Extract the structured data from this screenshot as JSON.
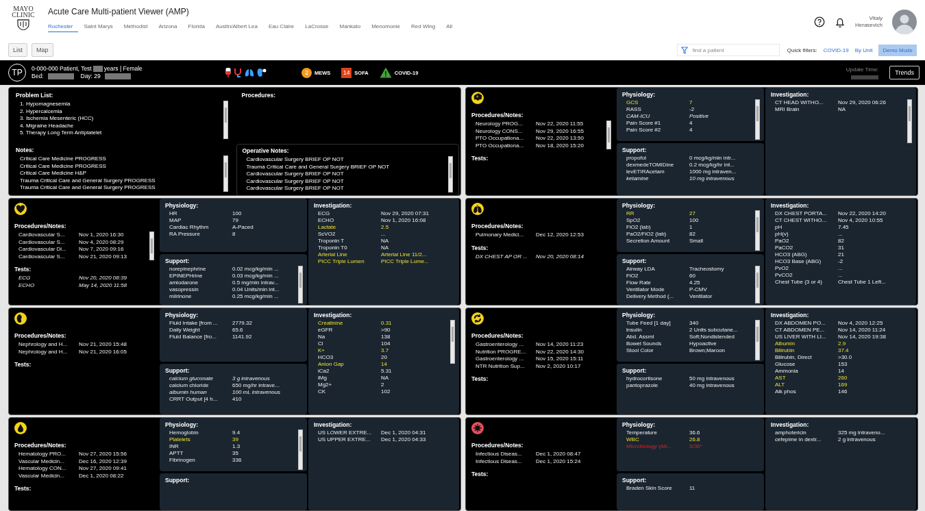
{
  "header": {
    "logo": [
      "MAYO",
      "CLINIC"
    ],
    "title": "Acute Care Multi-patient Viewer (AMP)",
    "locations": [
      {
        "label": "Rochester",
        "selected": true
      },
      {
        "label": "Saint Marys",
        "selected": false
      },
      {
        "label": "Methodist",
        "selected": false
      },
      {
        "label": "Arizona",
        "selected": false
      },
      {
        "label": "Florida",
        "selected": false
      },
      {
        "label": "Austin/Albert Lea",
        "selected": false
      },
      {
        "label": "Eau Claire",
        "selected": false
      },
      {
        "label": "LaCrosse",
        "selected": false
      },
      {
        "label": "Mankato",
        "selected": false
      },
      {
        "label": "Menomonie",
        "selected": false
      },
      {
        "label": "Red Wing",
        "selected": false
      },
      {
        "label": "All",
        "selected": false
      }
    ],
    "user": [
      "Vitaly",
      "Herasevich"
    ]
  },
  "toolbar": {
    "views": [
      "List",
      "Map"
    ],
    "search": {
      "placeholder": "find a patient"
    },
    "quick_filters_label": "Quick filters:",
    "quick_filters": [
      "COVID-19",
      "By Unit"
    ],
    "demo_mode": {
      "label": "Demo Mode",
      "on": true
    }
  },
  "patient": {
    "initials": "TP",
    "name": "0-000-000 Patient, Test",
    "age_sex": "years | Female",
    "bed_label": "Bed:",
    "day": "Day: 29",
    "scores": [
      {
        "kind": "circle",
        "value": "2",
        "label": "MEWS",
        "color": "#f39a1e"
      },
      {
        "kind": "square",
        "value": "14",
        "label": "SOFA",
        "color": "#e0401a"
      },
      {
        "kind": "triangle",
        "value": "!",
        "label": "COVID-19",
        "color": "#3fa535"
      }
    ],
    "update_label": "Update Time:",
    "trends": "Trends"
  },
  "panels": [
    {
      "kind": "summary",
      "problem_list": {
        "title": "Problem List:",
        "scrollbar": true,
        "items": [
          "1. Hypomagnesemia",
          "2. Hypercalcemia",
          "3. Ischemia Mesenteric (HCC)",
          "4. Migraine Headache",
          "5. Therapy Long Term Antiplatelet"
        ]
      },
      "notes": {
        "title": "Notes:",
        "scrollbar": true,
        "items": [
          "Critical Care Medicine PROGRESS",
          "Critical Care Medicine PROGRESS",
          "Critical Care Medicine H&P",
          "Trauma Critical Care and General Surgery PROGRESS",
          "Trauma Critical Care and General Surgery PROGRESS"
        ]
      },
      "procedures": {
        "title": "Procedures:"
      },
      "operative_notes": {
        "title": "Operative Notes:",
        "scrollbar": true,
        "items": [
          "Cardiovascular Surgery BRIEF OP NOT",
          "Trauma Critical Care and General Surgery BRIEF OP NOT",
          "Cardiovascular Surgery BRIEF OP NOT",
          "Cardiovascular Surgery BRIEF OP NOT",
          "Cardiovascular Surgery BRIEF OP NOT"
        ]
      }
    },
    {
      "kind": "neuro",
      "color": "#f2d31b",
      "notes": {
        "title": "Procedures/Notes:",
        "scrollbar": true,
        "rows": [
          {
            "label": "Neurology PROG...",
            "value": "Nov 22, 2020 11:55"
          },
          {
            "label": "Neurology CONS...",
            "value": "Nov 29, 2020 16:55"
          },
          {
            "label": "PTO Occupationa...",
            "value": "Nov 22, 2020 13:50"
          },
          {
            "label": "PTO Occupationa...",
            "value": "Nov 18, 2020 15:20"
          }
        ]
      },
      "tests": {
        "title": "Tests:"
      },
      "physiology": {
        "title": "Physiology:",
        "scrollbar": true,
        "rows": [
          {
            "label": "GCS",
            "value": "7",
            "abnormal": true,
            "stale": false
          },
          {
            "label": "RASS",
            "value": "-2",
            "abnormal": false,
            "stale": false
          },
          {
            "label": "CAM-ICU",
            "value": "Positive",
            "abnormal": false,
            "stale": true
          },
          {
            "label": "Pain Score #1",
            "value": "4",
            "abnormal": false,
            "stale": false
          },
          {
            "label": "Pain Score #2",
            "value": "4",
            "abnormal": false,
            "stale": false
          }
        ]
      },
      "support": {
        "title": "Support:",
        "rows": [
          {
            "label": "propofol",
            "value": "0 mcg/kg/min intr...",
            "abnormal": false,
            "stale": false
          },
          {
            "label": "dexmedeTOMIDine",
            "value": "0.2 mcg/kg/hr int...",
            "abnormal": false,
            "stale": false
          },
          {
            "label": "levETIRAcetam",
            "value": "1000 mg intraven...",
            "abnormal": false,
            "stale": false
          },
          {
            "label": "ketamine",
            "value": "10 mg intravenous",
            "abnormal": false,
            "stale": true
          }
        ]
      },
      "investigation": {
        "title": "Investigation:",
        "scrollbar": true,
        "rows": [
          {
            "label": "CT HEAD WITHO...",
            "value": "Nov 29, 2020 06:26",
            "abnormal": false,
            "stale": false
          },
          {
            "label": "MRI Brain",
            "value": "NA",
            "abnormal": false,
            "stale": false
          }
        ]
      }
    },
    {
      "kind": "cardio",
      "color": "#f2d31b",
      "notes": {
        "title": "Procedures/Notes:",
        "scrollbar": true,
        "rows": [
          {
            "label": "Cardiovascular S...",
            "value": "Nov 1, 2020 16:30"
          },
          {
            "label": "Cardiovascular S...",
            "value": "Nov 4, 2020 08:29"
          },
          {
            "label": "Cardiovascular Di...",
            "value": "Nov 7, 2020 09:16"
          },
          {
            "label": "Cardiovascular S...",
            "value": "Nov 21, 2020 09:13"
          }
        ]
      },
      "tests": {
        "title": "Tests:",
        "rows": [
          {
            "label": "ECG",
            "value": "Nov 20, 2020 08:39",
            "stale": true
          },
          {
            "label": "ECHO",
            "value": "May 14, 2020 11:58",
            "stale": true
          }
        ]
      },
      "physiology": {
        "title": "Physiology:",
        "rows": [
          {
            "label": "HR",
            "value": "100",
            "abnormal": false,
            "stale": false
          },
          {
            "label": "MAP",
            "value": "79",
            "abnormal": false,
            "stale": false
          },
          {
            "label": "Cardiac Rhythm",
            "value": "A-Paced",
            "abnormal": false,
            "stale": false
          },
          {
            "label": "RA Pressure",
            "value": "8",
            "abnormal": false,
            "stale": false
          }
        ]
      },
      "support": {
        "title": "Support:",
        "scrollbar": true,
        "rows": [
          {
            "label": "norepinephrine",
            "value": "0.02 mcg/kg/min ...",
            "abnormal": false,
            "stale": false
          },
          {
            "label": "EPINEPHrine",
            "value": "0.03 mcg/kg/min ...",
            "abnormal": false,
            "stale": false
          },
          {
            "label": "amiodarone",
            "value": "0.5 mg/min intrav...",
            "abnormal": false,
            "stale": false
          },
          {
            "label": "vasopressin",
            "value": "0.04 Units/min int...",
            "abnormal": false,
            "stale": false
          },
          {
            "label": "milrinone",
            "value": "0.25 mcg/kg/min ...",
            "abnormal": false,
            "stale": false
          }
        ]
      },
      "investigation": {
        "title": "Investigation:",
        "rows": [
          {
            "label": "ECG",
            "value": "Nov 29, 2020 07:31",
            "abnormal": false,
            "stale": false
          },
          {
            "label": "ECHO",
            "value": "Nov 1, 2020 16:08",
            "abnormal": false,
            "stale": false
          },
          {
            "label": "Lactate",
            "value": "2.5",
            "abnormal": true,
            "stale": false
          },
          {
            "label": "ScVO2",
            "value": "...",
            "abnormal": false,
            "stale": false
          },
          {
            "label": "Troponin T",
            "value": "NA",
            "abnormal": false,
            "stale": false
          },
          {
            "label": "Troponin T0",
            "value": "NA",
            "abnormal": false,
            "stale": false
          },
          {
            "label": "Arterial Line",
            "value": "Arterial Line 11/2...",
            "abnormal": true,
            "stale": false
          },
          {
            "label": "PICC Triple Lumen",
            "value": "PICC Triple Lume...",
            "abnormal": true,
            "stale": false
          }
        ]
      }
    },
    {
      "kind": "resp",
      "color": "#f2d31b",
      "notes": {
        "title": "Procedures/Notes:",
        "rows": [
          {
            "label": "Pulmonary Medici...",
            "value": "Dec 12, 2020 12:53"
          }
        ]
      },
      "tests": {
        "title": "Tests:",
        "rows": [
          {
            "label": "DX CHEST AP OR ...",
            "value": "Nov 20, 2020 08:14",
            "stale": true
          }
        ]
      },
      "physiology": {
        "title": "Physiology:",
        "scrollbar": true,
        "rows": [
          {
            "label": "RR",
            "value": "27",
            "abnormal": true,
            "stale": false
          },
          {
            "label": "SpO2",
            "value": "100",
            "abnormal": false,
            "stale": false
          },
          {
            "label": "FiO2 (lab)",
            "value": "1",
            "abnormal": false,
            "stale": false
          },
          {
            "label": "PaO2/FiO2 (lab)",
            "value": "82",
            "abnormal": false,
            "stale": false
          },
          {
            "label": "Secretion Amount",
            "value": "Small",
            "abnormal": false,
            "stale": false
          }
        ]
      },
      "support": {
        "title": "Support:",
        "scrollbar": true,
        "rows": [
          {
            "label": "Airway LDA",
            "value": "Tracheostomy",
            "abnormal": false,
            "stale": false
          },
          {
            "label": "FiO2",
            "value": "60",
            "abnormal": false,
            "stale": false
          },
          {
            "label": "Flow Rate",
            "value": "4.25",
            "abnormal": false,
            "stale": false
          },
          {
            "label": "Ventilator Mode",
            "value": "P-CMV",
            "abnormal": false,
            "stale": false
          },
          {
            "label": "Delivery Method (...",
            "value": "Ventilator",
            "abnormal": false,
            "stale": false
          }
        ]
      },
      "investigation": {
        "title": "Investigation:",
        "rows": [
          {
            "label": "DX CHEST PORTA...",
            "value": "Nov 22, 2020 14:20",
            "abnormal": false,
            "stale": false
          },
          {
            "label": "CT CHEST WITHO...",
            "value": "Nov 4, 2020 10:55",
            "abnormal": false,
            "stale": false
          },
          {
            "label": "pH",
            "value": "7.45",
            "abnormal": false,
            "stale": false
          },
          {
            "label": "pH(v)",
            "value": "...",
            "abnormal": false,
            "stale": false
          },
          {
            "label": "PaO2",
            "value": "82",
            "abnormal": false,
            "stale": false
          },
          {
            "label": "PaCO2",
            "value": "31",
            "abnormal": false,
            "stale": false
          },
          {
            "label": "HCO3 (ABG)",
            "value": "21",
            "abnormal": false,
            "stale": false
          },
          {
            "label": "HCO3 Base (ABG)",
            "value": "-2",
            "abnormal": false,
            "stale": false
          },
          {
            "label": "PvO2",
            "value": "...",
            "abnormal": false,
            "stale": false
          },
          {
            "label": "PvCO2",
            "value": "...",
            "abnormal": false,
            "stale": false
          },
          {
            "label": "Chest Tube (3 or 4)",
            "value": "Chest Tube 1 Left...",
            "abnormal": false,
            "stale": false
          }
        ]
      }
    },
    {
      "kind": "renal",
      "color": "#f2d31b",
      "notes": {
        "title": "Procedures/Notes:",
        "rows": [
          {
            "label": "Nephrology and H...",
            "value": "Nov 21, 2020 15:48"
          },
          {
            "label": "Nephrology and H...",
            "value": "Nov 21, 2020 16:05"
          }
        ]
      },
      "tests": {
        "title": "Tests:"
      },
      "physiology": {
        "title": "Physiology:",
        "rows": [
          {
            "label": "Fluid Intake [from ...",
            "value": "2779.32",
            "abnormal": false,
            "stale": false
          },
          {
            "label": "Daily Weight",
            "value": "65.6",
            "abnormal": false,
            "stale": false
          },
          {
            "label": "Fluid Balance [fro...",
            "value": "1141.92",
            "abnormal": false,
            "stale": false
          }
        ]
      },
      "support": {
        "title": "Support:",
        "rows": [
          {
            "label": "calcium gluconate",
            "value": "3 g intravenous",
            "abnormal": false,
            "stale": true
          },
          {
            "label": "calcium chloride",
            "value": "650 mg/hr intrave...",
            "abnormal": false,
            "stale": false
          },
          {
            "label": "albumin human",
            "value": "100 mL intravenous",
            "abnormal": false,
            "stale": true
          },
          {
            "label": "CRRT Output [4 h...",
            "value": "410",
            "abnormal": false,
            "stale": false
          }
        ]
      },
      "investigation": {
        "title": "Investigation:",
        "scrollbar": true,
        "rows": [
          {
            "label": "Creatinine",
            "value": "0.31",
            "abnormal": true,
            "stale": false
          },
          {
            "label": "eGFR",
            "value": ">90",
            "abnormal": false,
            "stale": false
          },
          {
            "label": "Na",
            "value": "138",
            "abnormal": false,
            "stale": false
          },
          {
            "label": "Cl",
            "value": "104",
            "abnormal": false,
            "stale": false
          },
          {
            "label": "K+",
            "value": "3.7",
            "abnormal": true,
            "stale": false
          },
          {
            "label": "HCO3",
            "value": "20",
            "abnormal": false,
            "stale": false
          },
          {
            "label": "Anion Gap",
            "value": "14",
            "abnormal": true,
            "stale": false
          },
          {
            "label": "iCa2",
            "value": "5.31",
            "abnormal": false,
            "stale": false
          },
          {
            "label": "iMg",
            "value": "NA",
            "abnormal": false,
            "stale": false
          },
          {
            "label": "Mg2+",
            "value": "2",
            "abnormal": false,
            "stale": false
          },
          {
            "label": "CK",
            "value": "102",
            "abnormal": false,
            "stale": false
          }
        ]
      }
    },
    {
      "kind": "gi",
      "color": "#f2d31b",
      "notes": {
        "title": "Procedures/Notes:",
        "rows": [
          {
            "label": "Gastroenterology ...",
            "value": "Nov 14, 2020 11:23"
          },
          {
            "label": "Nutrition PROGRE...",
            "value": "Nov 22, 2020 14:30"
          },
          {
            "label": "Gastroenterology ...",
            "value": "Nov 15, 2020 15:11"
          },
          {
            "label": "NTR Nutrition Sup...",
            "value": "Nov 2, 2020 10:17"
          }
        ]
      },
      "tests": {
        "title": "Tests:"
      },
      "physiology": {
        "title": "Physiology:",
        "scrollbar": true,
        "rows": [
          {
            "label": "Tube Feed [1 day]",
            "value": "340",
            "abnormal": false,
            "stale": false
          },
          {
            "label": "insulin",
            "value": "2 Units subcutane...",
            "abnormal": false,
            "stale": false
          },
          {
            "label": "Abd. Assmt",
            "value": "Soft;Nondistended",
            "abnormal": false,
            "stale": false
          },
          {
            "label": "Bowel Sounds",
            "value": "Hypoactive",
            "abnormal": false,
            "stale": false
          },
          {
            "label": "Stool Color",
            "value": "Brown;Maroon",
            "abnormal": false,
            "stale": false
          }
        ]
      },
      "support": {
        "title": "Support:",
        "rows": [
          {
            "label": "hydrocortisone",
            "value": "50 mg intravenous",
            "abnormal": false,
            "stale": false
          },
          {
            "label": "pantoprazole",
            "value": "40 mg intravenous",
            "abnormal": false,
            "stale": false
          }
        ]
      },
      "investigation": {
        "title": "Investigation:",
        "rows": [
          {
            "label": "DX ABDOMEN PO...",
            "value": "Nov 4, 2020 12:25",
            "abnormal": false,
            "stale": false
          },
          {
            "label": "CT ABDOMEN PE...",
            "value": "Nov 14, 2020 11:24",
            "abnormal": false,
            "stale": false
          },
          {
            "label": "US LIVER WITH LI...",
            "value": "Nov 14, 2020 19:38",
            "abnormal": false,
            "stale": false
          },
          {
            "label": "Albumin",
            "value": "2.9",
            "abnormal": true,
            "stale": false
          },
          {
            "label": "Bilirubin",
            "value": "37.4",
            "abnormal": true,
            "stale": false
          },
          {
            "label": "Bilirubin, Direct",
            "value": ">30.0",
            "abnormal": false,
            "stale": false
          },
          {
            "label": "Glucose",
            "value": "153",
            "abnormal": false,
            "stale": false
          },
          {
            "label": "Ammonia",
            "value": "14",
            "abnormal": false,
            "stale": false
          },
          {
            "label": "AST",
            "value": "260",
            "abnormal": true,
            "stale": false
          },
          {
            "label": "ALT",
            "value": "169",
            "abnormal": true,
            "stale": false
          },
          {
            "label": "Alk phos",
            "value": "146",
            "abnormal": false,
            "stale": false
          }
        ]
      }
    },
    {
      "kind": "heme",
      "color": "#f2d31b",
      "notes": {
        "title": "Procedures/Notes:",
        "rows": [
          {
            "label": "Hematology PRO...",
            "value": "Nov 27, 2020 15:56"
          },
          {
            "label": "Vascular Medicin...",
            "value": "Dec 16, 2020 12:39"
          },
          {
            "label": "Hematology CON...",
            "value": "Nov 27, 2020 09:41"
          },
          {
            "label": "Vascular Medicin...",
            "value": "Dec 1, 2020 08:22"
          }
        ]
      },
      "tests": {
        "title": "Tests:"
      },
      "physiology": {
        "title": "Physiology:",
        "scrollbar": true,
        "rows": [
          {
            "label": "Hemoglobin",
            "value": "9.4",
            "abnormal": false,
            "stale": false
          },
          {
            "label": "Platelets",
            "value": "39",
            "abnormal": true,
            "stale": false
          },
          {
            "label": "INR",
            "value": "1.3",
            "abnormal": false,
            "stale": false
          },
          {
            "label": "APTT",
            "value": "35",
            "abnormal": false,
            "stale": false
          },
          {
            "label": "Fibrinogen",
            "value": "336",
            "abnormal": false,
            "stale": false
          }
        ]
      },
      "support": {
        "title": "Support:"
      },
      "investigation": {
        "title": "Investigation:",
        "rows": [
          {
            "label": "US LOWER EXTRE...",
            "value": "Dec 1, 2020 04:31",
            "abnormal": false,
            "stale": false
          },
          {
            "label": "US UPPER EXTRE...",
            "value": "Dec 1, 2020 04:33",
            "abnormal": false,
            "stale": false
          }
        ]
      }
    },
    {
      "kind": "infection",
      "color": "#e8505b",
      "notes": {
        "title": "Procedures/Notes:",
        "rows": [
          {
            "label": "Infectious Diseas...",
            "value": "Dec 1, 2020 08:47"
          },
          {
            "label": "Infectious Diseas...",
            "value": "Dec 1, 2020 15:24"
          }
        ]
      },
      "tests": {
        "title": "Tests:"
      },
      "physiology": {
        "title": "Physiology:",
        "rows": [
          {
            "label": "Temperature",
            "value": "36.6",
            "abnormal": false,
            "critical": false,
            "stale": false
          },
          {
            "label": "WBC",
            "value": "26.8",
            "abnormal": true,
            "critical": false,
            "stale": false
          },
          {
            "label": "Microbiology (Ab...",
            "value": "5/36*",
            "abnormal": false,
            "critical": true,
            "stale": false
          }
        ]
      },
      "support": {
        "title": "Support:",
        "rows": [
          {
            "label": "Braden Skin Score",
            "value": "11",
            "abnormal": false,
            "stale": false
          }
        ]
      },
      "investigation": {
        "title": "Investigation:",
        "rows": [
          {
            "label": "amphotericin",
            "value": "325 mg intraveno...",
            "abnormal": false,
            "stale": false
          },
          {
            "label": "cefepime in dextr...",
            "value": "2 g intravenous",
            "abnormal": false,
            "stale": false
          }
        ]
      }
    }
  ]
}
